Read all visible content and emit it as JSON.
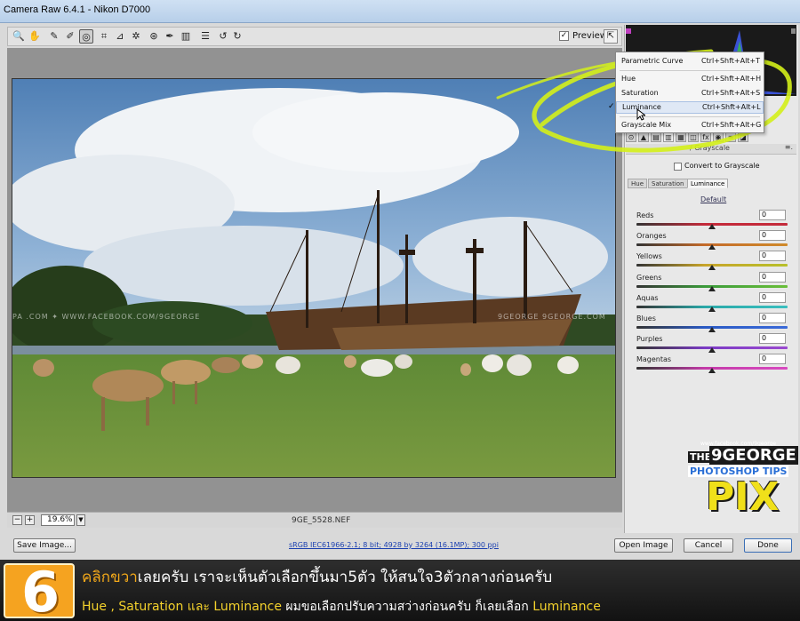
{
  "window": {
    "title": "Camera Raw 6.4.1  -  Nikon D7000"
  },
  "toolbar": {
    "tools": [
      {
        "name": "zoom-tool-icon",
        "glyph": "🔍"
      },
      {
        "name": "hand-tool-icon",
        "glyph": "✋"
      },
      {
        "name": "white-balance-tool-icon",
        "glyph": "✎"
      },
      {
        "name": "color-sampler-tool-icon",
        "glyph": "✐"
      },
      {
        "name": "targeted-adjustment-tool-icon",
        "glyph": "◎"
      },
      {
        "name": "crop-tool-icon",
        "glyph": "⌗"
      },
      {
        "name": "straighten-tool-icon",
        "glyph": "⊿"
      },
      {
        "name": "spot-removal-tool-icon",
        "glyph": "✲"
      },
      {
        "name": "red-eye-tool-icon",
        "glyph": "⊛"
      },
      {
        "name": "adjustment-brush-icon",
        "glyph": "✒"
      },
      {
        "name": "graduated-filter-icon",
        "glyph": "▥"
      },
      {
        "name": "preferences-icon",
        "glyph": "☰"
      },
      {
        "name": "rotate-left-icon",
        "glyph": "↺"
      },
      {
        "name": "rotate-right-icon",
        "glyph": "↻"
      }
    ],
    "preview_label": "Preview",
    "preview_checked": "✓"
  },
  "canvas": {
    "watermark_left": "PA   .COM   ✦ WWW.FACEBOOK.COM/9GEORGE",
    "watermark_right": "9GEORGE  9GEORGE.COM",
    "zoom_value": "19.6%",
    "zoom_minus": "−",
    "zoom_plus": "+",
    "filename": "9GE_5528.NEF"
  },
  "context_menu": {
    "items": [
      {
        "label": "Parametric Curve",
        "shortcut": "Ctrl+Shft+Alt+T"
      },
      {
        "label": "Hue",
        "shortcut": "Ctrl+Shft+Alt+H"
      },
      {
        "label": "Saturation",
        "shortcut": "Ctrl+Shft+Alt+S"
      },
      {
        "label": "Luminance",
        "shortcut": "Ctrl+Shft+Alt+L",
        "checked": "✓"
      },
      {
        "label": "Grayscale Mix",
        "shortcut": "Ctrl+Shft+Alt+G"
      }
    ]
  },
  "panel": {
    "header": "/ Grayscale",
    "menu_glyph": "≡.",
    "convert_label": "Convert to Grayscale",
    "tabs": [
      "Hue",
      "Saturation",
      "Luminance"
    ],
    "default_label": "Default",
    "sliders": [
      {
        "label": "Reds",
        "value": "0",
        "color_a": "#c42a3a",
        "color_b": "#c42a3a"
      },
      {
        "label": "Oranges",
        "value": "0",
        "color_a": "#c46a2a",
        "color_b": "#d08a2a"
      },
      {
        "label": "Yellows",
        "value": "0",
        "color_a": "#c7a42a",
        "color_b": "#b8c02a"
      },
      {
        "label": "Greens",
        "value": "0",
        "color_a": "#3a9a3a",
        "color_b": "#6abf3a"
      },
      {
        "label": "Aquas",
        "value": "0",
        "color_a": "#2aa8a8",
        "color_b": "#3abfbf"
      },
      {
        "label": "Blues",
        "value": "0",
        "color_a": "#2a5ac4",
        "color_b": "#3a6ad8"
      },
      {
        "label": "Purples",
        "value": "0",
        "color_a": "#7a3ac4",
        "color_b": "#9a4ad0"
      },
      {
        "label": "Magentas",
        "value": "0",
        "color_a": "#c43aa8",
        "color_b": "#d84ac0"
      }
    ]
  },
  "logo": {
    "url_line": "www.facebook.com/9george",
    "the": "THE",
    "brand": "9GEORGE",
    "subtitle": "PHOTOSHOP TIPS",
    "pix": "PIX"
  },
  "bottom_bar": {
    "save_label": "Save Image...",
    "file_info": "sRGB IEC61966-2.1; 8 bit; 4928 by 3264 (16.1MP); 300 ppi",
    "open_label": "Open Image",
    "cancel_label": "Cancel",
    "done_label": "Done"
  },
  "caption": {
    "step": "6",
    "line1_accent": "คลิกขวา",
    "line1_rest": "เลยครับ เราจะเห็นตัวเลือกขึ้นมา5ตัว ให้สนใจ3ตัวกลางก่อนครับ",
    "line2_hue_sat": "Hue , Saturation และ Luminance",
    "line2_middle": " ผมขอเลือกปรับความสว่างก่อนครับ ก็เลยเลือก ",
    "line2_lum": "Luminance"
  },
  "colors": {
    "accent_orange": "#f2a81a",
    "highlight_yellow": "#d4f01a",
    "caption_yellow": "#f4d22c"
  }
}
